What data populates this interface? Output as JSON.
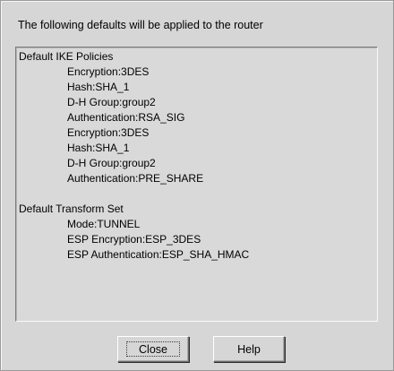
{
  "dialog": {
    "intro_text": "The following defaults will be applied to the router"
  },
  "defaults": {
    "ike": {
      "title": "Default IKE Policies",
      "lines": [
        "Encryption:3DES",
        "Hash:SHA_1",
        "D-H Group:group2",
        "Authentication:RSA_SIG",
        "Encryption:3DES",
        "Hash:SHA_1",
        "D-H Group:group2",
        "Authentication:PRE_SHARE"
      ]
    },
    "transform": {
      "title": "Default Transform Set",
      "lines": [
        "Mode:TUNNEL",
        "ESP Encryption:ESP_3DES",
        "ESP Authentication:ESP_SHA_HMAC"
      ]
    }
  },
  "buttons": {
    "close_label": "Close",
    "help_label": "Help"
  }
}
